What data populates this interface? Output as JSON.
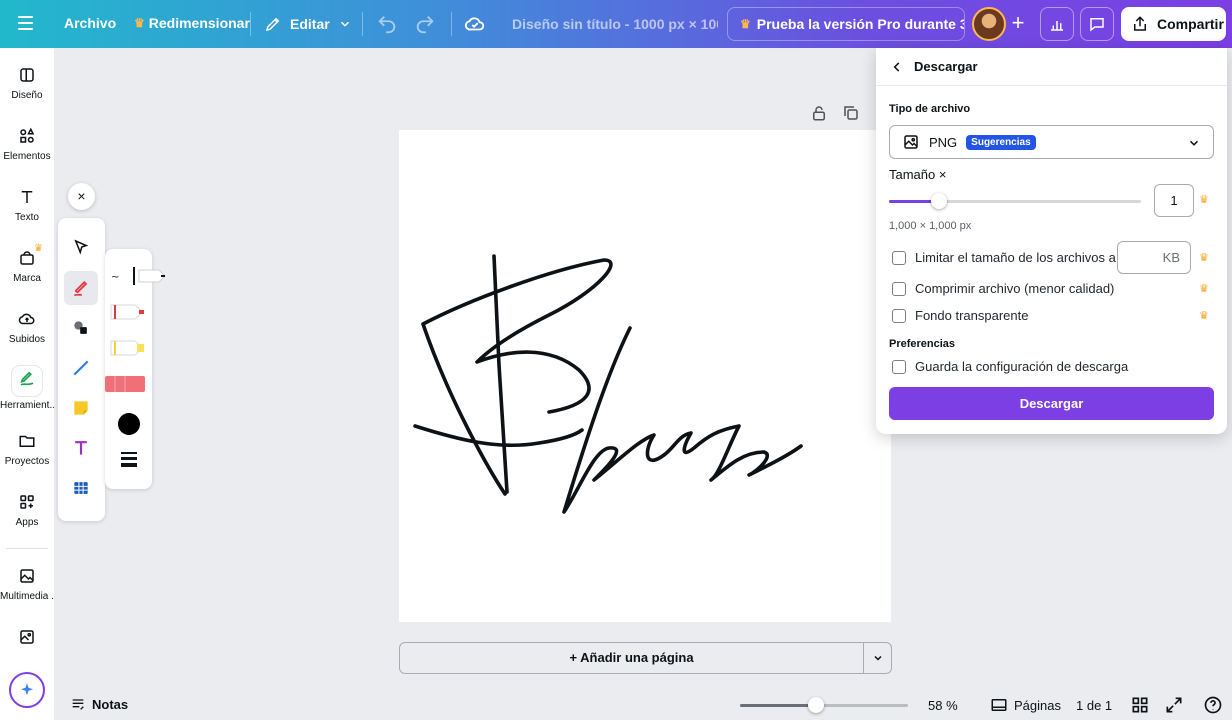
{
  "topbar": {
    "menu_icon": "hamburger-icon",
    "archivo": "Archivo",
    "resize": "Redimensionar",
    "edit": "Editar",
    "title": "Diseño sin título - 1000 px × 100...",
    "pro_trial": "Prueba la versión Pro durante 3...",
    "plus": "+",
    "share": "Compartir"
  },
  "sidebar": {
    "items": [
      {
        "label": "Diseño",
        "icon": "layout-icon"
      },
      {
        "label": "Elementos",
        "icon": "shapes-icon"
      },
      {
        "label": "Texto",
        "icon": "text-icon"
      },
      {
        "label": "Marca",
        "icon": "brand-icon"
      },
      {
        "label": "Subidos",
        "icon": "upload-cloud-icon"
      },
      {
        "label": "Herramient...",
        "icon": "draw-tool-icon"
      },
      {
        "label": "Proyectos",
        "icon": "folder-icon"
      },
      {
        "label": "Apps",
        "icon": "apps-icon"
      },
      {
        "label": "Multimedia ...",
        "icon": "media-icon"
      }
    ]
  },
  "drawbar": {
    "close": "×",
    "tools": [
      "select-arrow-icon",
      "pen-icon",
      "shape-icon",
      "line-icon",
      "sticky-note-icon",
      "text-tool-icon",
      "table-icon"
    ],
    "pens": [
      "pen-tip-icon",
      "marker-red-icon",
      "highlighter-yellow-icon",
      "eraser-icon",
      "color-swatch-icon",
      "stroke-weight-icon"
    ],
    "pen_colors": {
      "marker": "#e63946",
      "highlighter": "#f7e35a",
      "eraser": "#f0707a",
      "swatch": "#000000"
    }
  },
  "canvas": {
    "add_page": "+ Añadir una página"
  },
  "bottombar": {
    "notes": "Notas",
    "zoom": "58 %",
    "zoom_fraction": 0.45,
    "pages": "Páginas",
    "page_count": "1 de 1"
  },
  "download": {
    "header": "Descargar",
    "file_type_label": "Tipo de archivo",
    "file_type": "PNG",
    "suggestion_badge": "Sugerencias",
    "size_label": "Tamaño ×",
    "size_value": "1",
    "size_fraction": 0.2,
    "dimensions": "1,000 × 1,000 px",
    "limit_label": "Limitar el tamaño de los archivos a",
    "kb_unit": "KB",
    "compress_label": "Comprimir archivo (menor calidad)",
    "transparent_label": "Fondo transparente",
    "preferences_label": "Preferencias",
    "save_settings_label": "Guarda la configuración de descarga",
    "download_button": "Descargar"
  },
  "colors": {
    "accent": "#7b3fe4",
    "badge": "#2254e6",
    "crown": "#f5a623"
  }
}
